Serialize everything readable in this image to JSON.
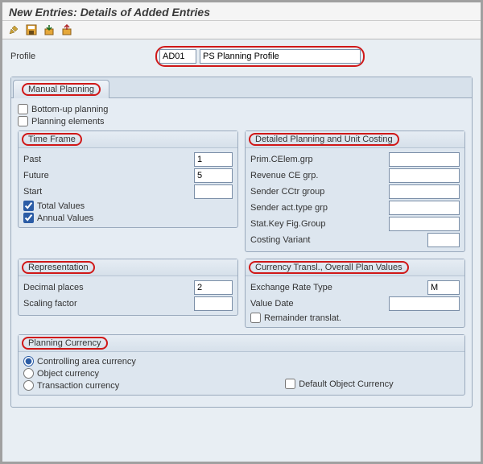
{
  "title": "New Entries: Details of Added Entries",
  "profile": {
    "label": "Profile",
    "code": "AD01",
    "name": "PS Planning Profile"
  },
  "manualPlanning": {
    "tab": "Manual Planning",
    "bottomUp": "Bottom-up planning",
    "planningElements": "Planning elements"
  },
  "timeFrame": {
    "title": "Time Frame",
    "past": {
      "label": "Past",
      "value": "1"
    },
    "future": {
      "label": "Future",
      "value": "5"
    },
    "start": {
      "label": "Start",
      "value": ""
    },
    "totalValues": "Total Values",
    "annualValues": "Annual Values"
  },
  "detailed": {
    "title": "Detailed Planning and Unit Costing",
    "primCElemGrp": {
      "label": "Prim.CElem.grp",
      "value": ""
    },
    "revenueCEgrp": {
      "label": "Revenue CE grp.",
      "value": ""
    },
    "senderCCtrGroup": {
      "label": "Sender CCtr group",
      "value": ""
    },
    "senderActTypeGrp": {
      "label": "Sender act.type grp",
      "value": ""
    },
    "statKeyFigGroup": {
      "label": "Stat.Key Fig.Group",
      "value": ""
    },
    "costingVariant": {
      "label": "Costing Variant",
      "value": ""
    }
  },
  "representation": {
    "title": "Representation",
    "decimalPlaces": {
      "label": "Decimal places",
      "value": "2"
    },
    "scalingFactor": {
      "label": "Scaling factor",
      "value": ""
    }
  },
  "currencyTransl": {
    "title": "Currency Transl., Overall Plan Values",
    "exchangeRateType": {
      "label": "Exchange Rate Type",
      "value": "M"
    },
    "valueDate": {
      "label": "Value Date",
      "value": ""
    },
    "remainderTranslat": "Remainder translat."
  },
  "planningCurrency": {
    "title": "Planning Currency",
    "controllingArea": "Controlling area currency",
    "object": "Object currency",
    "transaction": "Transaction currency",
    "defaultObject": "Default Object Currency"
  }
}
